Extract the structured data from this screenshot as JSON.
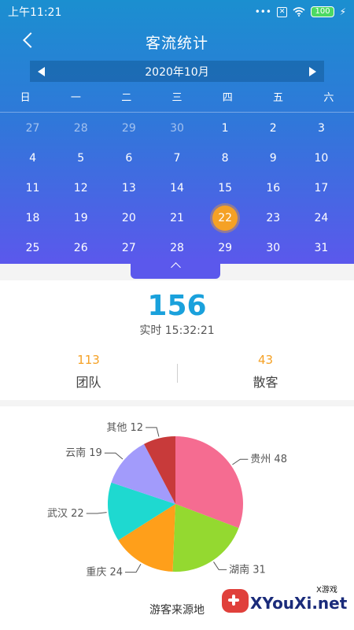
{
  "status": {
    "time": "上午11:21",
    "dots": "•••",
    "sim": "✕",
    "wifi": "wifi-icon",
    "battery": "100"
  },
  "header": {
    "title": "客流统计"
  },
  "calendar": {
    "month": "2020年10月",
    "weekdays": [
      "日",
      "一",
      "二",
      "三",
      "四",
      "五",
      "六"
    ],
    "rows": [
      [
        "27",
        "28",
        "29",
        "30",
        "1",
        "2",
        "3"
      ],
      [
        "4",
        "5",
        "6",
        "7",
        "8",
        "9",
        "10"
      ],
      [
        "11",
        "12",
        "13",
        "14",
        "15",
        "16",
        "17"
      ],
      [
        "18",
        "19",
        "20",
        "21",
        "22",
        "23",
        "24"
      ],
      [
        "25",
        "26",
        "27",
        "28",
        "29",
        "30",
        "31"
      ]
    ],
    "muted_first_row_count": 4,
    "selected": "22"
  },
  "stats": {
    "total": "156",
    "realtime": "实时 15:32:21",
    "team_value": "113",
    "team_label": "团队",
    "individual_value": "43",
    "individual_label": "散客"
  },
  "chart_data": {
    "type": "pie",
    "title": "游客来源地",
    "slices": [
      {
        "name": "贵州",
        "value": 48,
        "label": "贵州 48",
        "color": "#f56c91"
      },
      {
        "name": "湖南",
        "value": 31,
        "label": "湖南 31",
        "color": "#94d930"
      },
      {
        "name": "重庆",
        "value": 24,
        "label": "重庆 24",
        "color": "#ff9f1a"
      },
      {
        "name": "武汉",
        "value": 22,
        "label": "武汉 22",
        "color": "#1ed9d0"
      },
      {
        "name": "云南",
        "value": 19,
        "label": "云南 19",
        "color": "#a29bfb"
      },
      {
        "name": "其他",
        "value": 12,
        "label": "其他 12",
        "color": "#c83a3a"
      }
    ]
  },
  "watermark": {
    "small": "X游戏",
    "main": "XYouXi.net"
  },
  "colors": {
    "accent": "#1aa1dc",
    "orange": "#f5a125"
  }
}
